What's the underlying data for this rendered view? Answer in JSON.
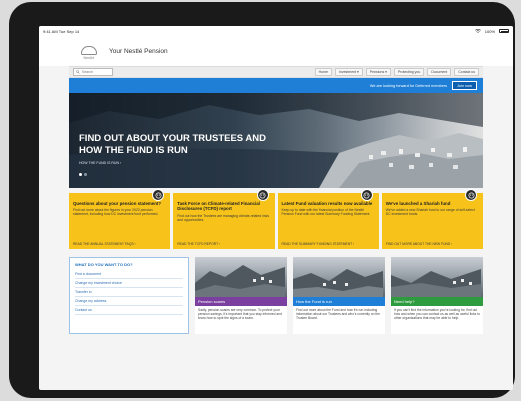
{
  "status": {
    "time": "9:41 AM",
    "date": "Tue Sep 14",
    "battery": "100%"
  },
  "brand": {
    "logo_text": "Nestlé",
    "title": "Your Nestlé Pension"
  },
  "nav": {
    "search_placeholder": "Search",
    "items": [
      "Home",
      "Investment ▾",
      "Pensions ▾",
      "Protecting you",
      "Document",
      "Contact us"
    ]
  },
  "banner": {
    "message": "We are looking forward for Deferred members",
    "button": "Join now"
  },
  "hero": {
    "title": "FIND OUT ABOUT YOUR TRUSTEES AND HOW THE FUND IS RUN",
    "link": "HOW THE FUND IS RUN  ›"
  },
  "cards": [
    {
      "title": "Questions about your pension statement?",
      "body": "Find out more about the figures in your 2022 pension statement, including how DC investment fund performed.",
      "more": "READ THE ANNUAL STATEMENT FAQS  ›"
    },
    {
      "title": "Task Force on Climate-related Financial Disclosures (TCFD) report",
      "body": "Find out how the Trustees are managing climate-related risks and opportunities.",
      "more": "READ THE TCFD REPORT  ›"
    },
    {
      "title": "Latest Fund valuation results now available",
      "body": "Keep up to date with the financial position of the Nestlé Pension Fund with our latest Summary Funding Statement.",
      "more": "READ THE SUMMARY FUNDING STATEMENT  ›"
    },
    {
      "title": "We've launched a Shariah fund",
      "body": "We've added a new Shariah fund to our range of self-select DC investment funds.",
      "more": "FIND OUT MORE ABOUT THE NEW FUND  ›"
    }
  ],
  "todo": {
    "title": "WHAT DO YOU WANT TO DO?",
    "items": [
      "Find a document",
      "Change my investment choice",
      "Transfer in",
      "Change my address",
      "Contact us"
    ]
  },
  "tiles": [
    {
      "label": "Pension scams",
      "color": "#7b3fa0",
      "text": "Sadly, pension scams are very common. To protect your pension savings, it's important that you stay informed and know how to spot the signs of a scam."
    },
    {
      "label": "How the Fund is run",
      "color": "#1f7fd6",
      "text": "Find out more about the Fund and how it's run including information about our Trustees and who's currently on the Trustee Board."
    },
    {
      "label": "Need help?",
      "color": "#2e9b3f",
      "text": "If you can't find the information you're looking for, find out how and when you can contact us as well as useful links to other organisations that may be able to help."
    }
  ],
  "colors": {
    "accent_blue": "#1f7fd6",
    "card_yellow": "#f7c31a"
  }
}
